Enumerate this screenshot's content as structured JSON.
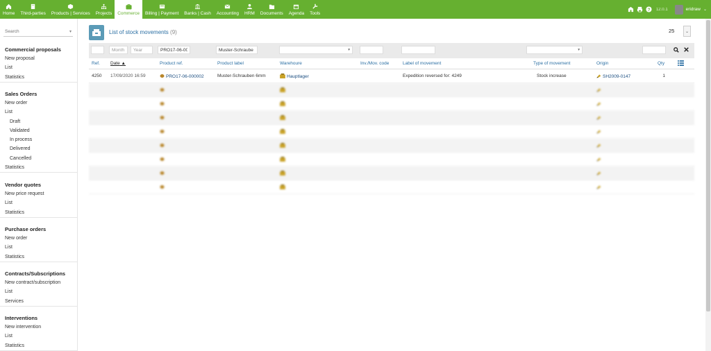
{
  "topmenu": [
    {
      "label": "Home",
      "icon": "home-icon"
    },
    {
      "label": "Third-parties",
      "icon": "building-icon"
    },
    {
      "label": "Products | Services",
      "icon": "cube-icon"
    },
    {
      "label": "Projects",
      "icon": "sitemap-icon"
    },
    {
      "label": "Commerce",
      "icon": "briefcase-icon",
      "active": true
    },
    {
      "label": "Billing | Payment",
      "icon": "money-icon"
    },
    {
      "label": "Banks | Cash",
      "icon": "bank-icon"
    },
    {
      "label": "Accounting",
      "icon": "envelope-icon"
    },
    {
      "label": "HRM",
      "icon": "user-icon"
    },
    {
      "label": "Documents",
      "icon": "folder-icon"
    },
    {
      "label": "Agenda",
      "icon": "calendar-icon"
    },
    {
      "label": "Tools",
      "icon": "wrench-icon"
    }
  ],
  "topright": {
    "version": "12.0.1",
    "username": "eridraw"
  },
  "sidebar": {
    "search_placeholder": "Search",
    "sections": [
      {
        "title": "Commercial proposals",
        "links": [
          "New proposal",
          "List",
          "Statistics"
        ]
      },
      {
        "title": "Sales Orders",
        "links": [
          "New order",
          "List"
        ],
        "sublinks": [
          "Draft",
          "Validated",
          "In process",
          "Delivered",
          "Cancelled"
        ],
        "after": [
          "Statistics"
        ]
      },
      {
        "title": "Vendor quotes",
        "links": [
          "New price request",
          "List",
          "Statistics"
        ]
      },
      {
        "title": "Purchase orders",
        "links": [
          "New order",
          "List",
          "Statistics"
        ]
      },
      {
        "title": "Contracts/Subscriptions",
        "links": [
          "New contract/subscription",
          "List",
          "Services"
        ]
      },
      {
        "title": "Interventions",
        "links": [
          "New intervention",
          "List",
          "Statistics"
        ]
      }
    ]
  },
  "page": {
    "title": "List of stock movements",
    "count": "(9)",
    "per_page": "25"
  },
  "filters": {
    "month_placeholder": "Month",
    "year_placeholder": "Year",
    "product_ref": "PRO17-06-00",
    "product_label": "Muster-Schraube"
  },
  "columns": [
    "Ref.",
    "Date",
    "Product ref.",
    "Product label",
    "Warehoure",
    "Inv./Mov. code",
    "Label of movement",
    "Type of movement",
    "Origin",
    "Qty"
  ],
  "rows": [
    {
      "ref": "4250",
      "date": "17/09/2020 16:59",
      "product_ref": "PRO17-06-000002",
      "product_label": "Muster-Schrauben 6mm",
      "warehouse": "Hauptlager",
      "code": "",
      "label": "Expedition reversed for: 4249",
      "type": "Stock increase",
      "origin": "SH2009-0147",
      "qty": "1",
      "blurred": false
    },
    {
      "ref": "",
      "date": "",
      "product_ref": "",
      "product_label": "",
      "warehouse": "",
      "code": "",
      "label": "",
      "type": "",
      "origin": "",
      "qty": "",
      "blurred": true
    },
    {
      "ref": "",
      "date": "",
      "product_ref": "",
      "product_label": "",
      "warehouse": "",
      "code": "",
      "label": "",
      "type": "",
      "origin": "",
      "qty": "",
      "blurred": true
    },
    {
      "ref": "",
      "date": "",
      "product_ref": "",
      "product_label": "",
      "warehouse": "",
      "code": "",
      "label": "",
      "type": "",
      "origin": "",
      "qty": "",
      "blurred": true
    },
    {
      "ref": "",
      "date": "",
      "product_ref": "",
      "product_label": "",
      "warehouse": "",
      "code": "",
      "label": "",
      "type": "",
      "origin": "",
      "qty": "",
      "blurred": true
    },
    {
      "ref": "",
      "date": "",
      "product_ref": "",
      "product_label": "",
      "warehouse": "",
      "code": "",
      "label": "",
      "type": "",
      "origin": "",
      "qty": "",
      "blurred": true
    },
    {
      "ref": "",
      "date": "",
      "product_ref": "",
      "product_label": "",
      "warehouse": "",
      "code": "",
      "label": "",
      "type": "",
      "origin": "",
      "qty": "",
      "blurred": true
    },
    {
      "ref": "",
      "date": "",
      "product_ref": "",
      "product_label": "",
      "warehouse": "",
      "code": "",
      "label": "",
      "type": "",
      "origin": "",
      "qty": "",
      "blurred": true
    },
    {
      "ref": "",
      "date": "",
      "product_ref": "",
      "product_label": "",
      "warehouse": "",
      "code": "",
      "label": "",
      "type": "",
      "origin": "",
      "qty": "",
      "blurred": true
    }
  ],
  "colors": {
    "brand_green": "#66b030",
    "link_blue": "#2b6fa3",
    "title_icon": "#5b9bb7"
  }
}
